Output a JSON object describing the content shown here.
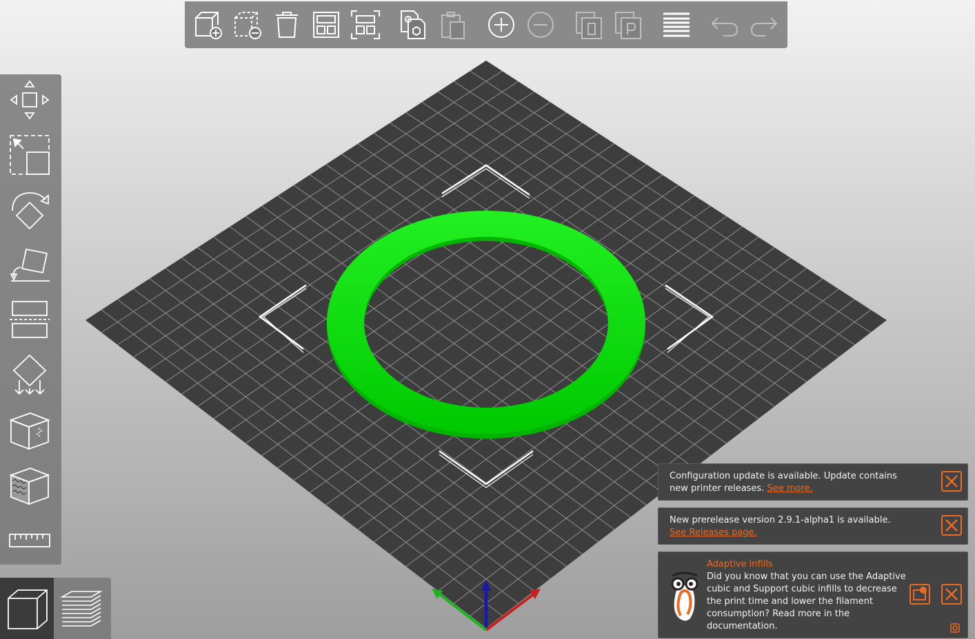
{
  "app": {
    "accent_color": "#ed6b21",
    "object_color": "#00e000",
    "bed_color": "#3d3d3d"
  },
  "top_toolbar": {
    "items": [
      {
        "name": "add-icon",
        "enabled": true
      },
      {
        "name": "delete-icon",
        "enabled": true
      },
      {
        "name": "delete-all-icon",
        "enabled": true
      },
      {
        "name": "arrange-icon",
        "enabled": true
      },
      {
        "name": "arrange-selection-icon",
        "enabled": true
      },
      {
        "name": "copy-icon",
        "enabled": true
      },
      {
        "name": "paste-icon",
        "enabled": false
      },
      {
        "name": "add-instance-icon",
        "enabled": true
      },
      {
        "name": "remove-instance-icon",
        "enabled": false
      },
      {
        "name": "split-to-objects-icon",
        "enabled": false
      },
      {
        "name": "split-to-parts-icon",
        "enabled": false
      },
      {
        "name": "variable-layer-height-icon",
        "enabled": true
      },
      {
        "name": "undo-icon",
        "enabled": false
      },
      {
        "name": "redo-icon",
        "enabled": false
      }
    ]
  },
  "left_toolbar": {
    "items": [
      "move-icon",
      "scale-icon",
      "rotate-icon",
      "place-on-face-icon",
      "cut-icon",
      "support-painting-icon",
      "seam-painting-icon",
      "fuzzy-skin-icon",
      "measure-icon"
    ]
  },
  "view_toolbar": {
    "items": [
      "3d-view-icon",
      "preview-layers-icon"
    ],
    "active": "3d-view-icon"
  },
  "notifications": {
    "config_update": {
      "text": "Configuration update is available. Update contains new printer releases.",
      "link": "See more."
    },
    "prerelease": {
      "text": "New prerelease version 2.9.1-alpha1 is available.",
      "link": "See Releases page."
    },
    "hint": {
      "title": "Adaptive infills",
      "text": "Did you know that you can use the Adaptive cubic and Support cubic infills to decrease the print time and lower the filament consumption? Read more in the documentation."
    }
  }
}
